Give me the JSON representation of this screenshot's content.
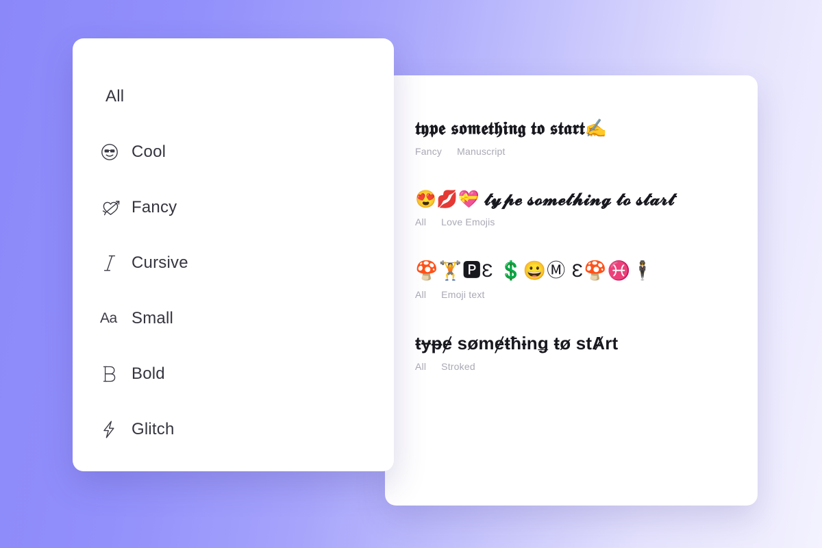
{
  "theme": {
    "background_gradient_from": "#8b88fa",
    "background_gradient_to": "#f3f2fe",
    "card_background": "#ffffff",
    "label_color": "#35353f",
    "tag_color": "#a9a9b5",
    "result_text_color": "#18181f"
  },
  "sidebar": {
    "items": [
      {
        "label": "All",
        "icon": "none"
      },
      {
        "label": "Cool",
        "icon": "sunglasses-smiley-icon"
      },
      {
        "label": "Fancy",
        "icon": "heart-arrow-icon"
      },
      {
        "label": "Cursive",
        "icon": "italic-i-icon"
      },
      {
        "label": "Small",
        "icon": "aa-icon",
        "icon_text": "Aa"
      },
      {
        "label": "Bold",
        "icon": "outline-b-icon"
      },
      {
        "label": "Glitch",
        "icon": "lightning-bolt-icon"
      }
    ]
  },
  "results": {
    "items": [
      {
        "text": "𝖙𝖞𝖕𝖊 𝖘𝖔𝖒𝖊𝖙𝖍𝖎𝖓𝖌 𝖙𝖔 𝖘𝖙𝖆𝖗𝖙✍️",
        "style": "fraktur",
        "tags": [
          "Fancy",
          "Manuscript"
        ]
      },
      {
        "text": "😍💋💝 𝓽𝔂𝓹𝓮 𝓼𝓸𝓶𝓮𝓽𝓱𝓲𝓷𝓰 𝓽𝓸 𝓼𝓽𝓪𝓻𝓽",
        "style": "script",
        "tags": [
          "All",
          "Love Emojis"
        ]
      },
      {
        "text": "🍄🏋🅿Ɛ 💲😀Ⓜ Ɛ🍄♓🕴",
        "style": "emoji",
        "tags": [
          "All",
          "Emoji text"
        ]
      },
      {
        "text": "ŧɏᵽɇ sømɇŧħɨnǥ ŧø stȺrt",
        "style": "stroked",
        "tags": [
          "All",
          "Stroked"
        ]
      }
    ]
  }
}
